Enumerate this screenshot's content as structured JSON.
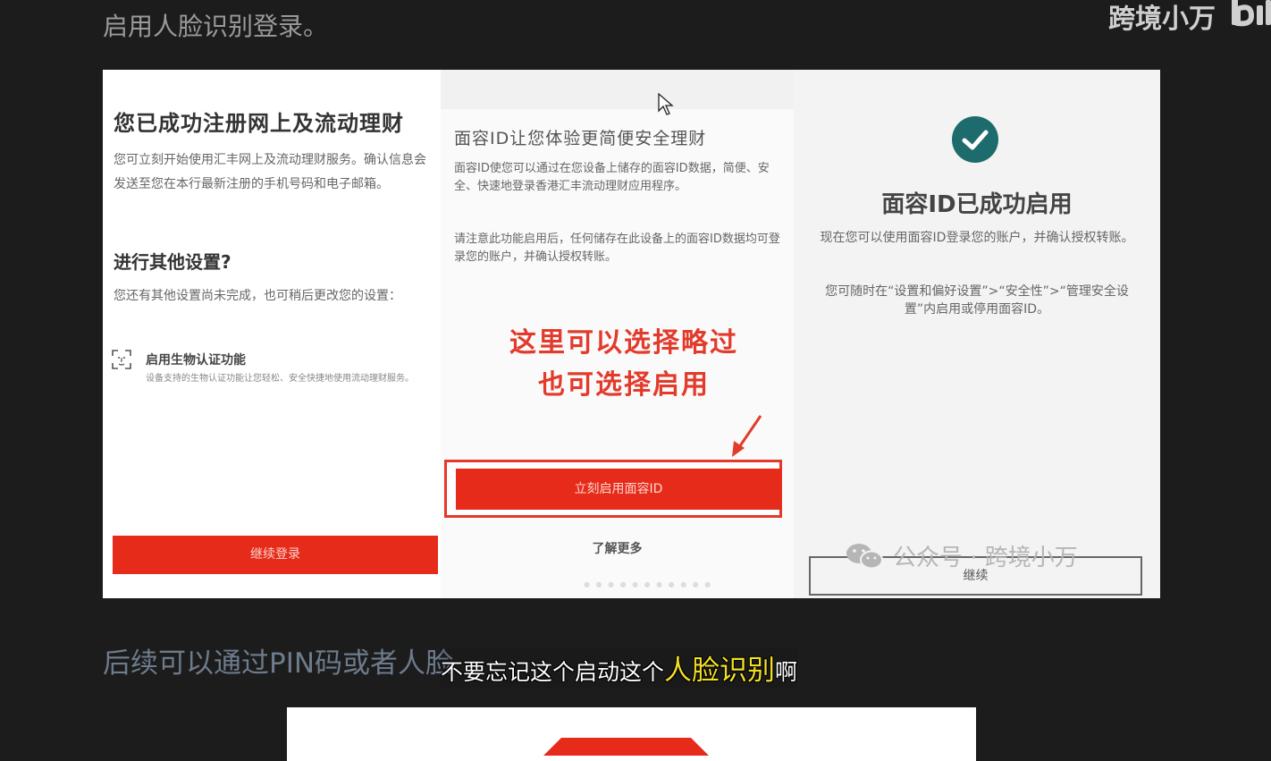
{
  "top_text": "启用人脸识别登录。",
  "watermark": "跨境小万",
  "panel_left": {
    "title": "您已成功注册网上及流动理财",
    "desc": "您可立刻开始使用汇丰网上及流动理财服务。确认信息会发送至您在本行最新注册的手机号码和电子邮箱。",
    "subtitle": "进行其他设置?",
    "desc2": "您还有其他设置尚未完成，也可稍后更改您的设置：",
    "bio_title": "启用生物认证功能",
    "bio_desc": "设备支持的生物认证功能让您轻松、安全快捷地使用流动理财服务。",
    "button": "继续登录"
  },
  "panel_mid": {
    "title": "面容ID让您体验更简便安全理财",
    "desc1": "面容ID使您可以通过在您设备上储存的面容ID数据，简便、安全、快速地登录香港汇丰流动理财应用程序。",
    "desc2": "请注意此功能启用后，任何储存在此设备上的面容ID数据均可登录您的账户，并确认授权转账。",
    "annotation_line1": "这里可以选择略过",
    "annotation_line2": "也可选择启用",
    "enable_button": "立刻启用面容ID",
    "learn_more": "了解更多"
  },
  "panel_right": {
    "title": "面容ID已成功启用",
    "desc1": "现在您可以使用面容ID登录您的账户，并确认授权转账。",
    "desc2": "您可随时在“设置和偏好设置”>“安全性”>“管理安全设置”内启用或停用面容ID。",
    "wechat_watermark": "公众号 · 跨境小万",
    "continue_button": "继续"
  },
  "bottom_text": "后续可以通过PIN码或者人脸",
  "subtitle": {
    "part1": "不要忘记这个启动这个",
    "highlight": "人脸识别",
    "part2": "啊"
  },
  "colors": {
    "accent_red": "#e72b1a",
    "check_teal": "#1e6b6d",
    "highlight_yellow": "#f2de26"
  }
}
